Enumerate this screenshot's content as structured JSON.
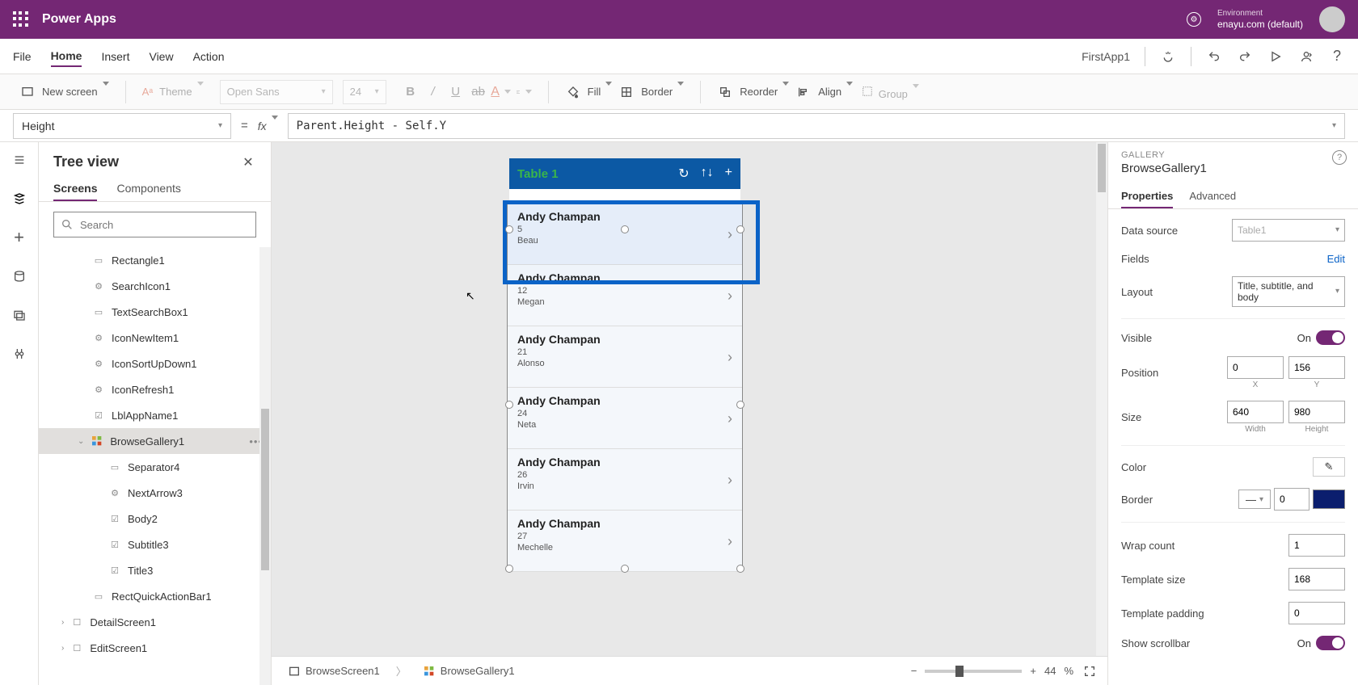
{
  "topbar": {
    "brand": "Power Apps",
    "env_label": "Environment",
    "env_value": "enayu.com (default)"
  },
  "menubar": {
    "items": [
      "File",
      "Home",
      "Insert",
      "View",
      "Action"
    ],
    "active": "Home",
    "app_name": "FirstApp1"
  },
  "toolbar": {
    "new_screen": "New screen",
    "theme": "Theme",
    "font": "Open Sans",
    "font_size": "24",
    "fill": "Fill",
    "border": "Border",
    "reorder": "Reorder",
    "align": "Align",
    "group": "Group"
  },
  "formula": {
    "property": "Height",
    "expr": "Parent.Height - Self.Y"
  },
  "tree": {
    "title": "Tree view",
    "tabs": [
      "Screens",
      "Components"
    ],
    "active_tab": "Screens",
    "search_placeholder": "Search",
    "items": [
      {
        "label": "Rectangle1",
        "indent": 1,
        "icon": "rect"
      },
      {
        "label": "SearchIcon1",
        "indent": 1,
        "icon": "ctl"
      },
      {
        "label": "TextSearchBox1",
        "indent": 1,
        "icon": "input"
      },
      {
        "label": "IconNewItem1",
        "indent": 1,
        "icon": "ctl"
      },
      {
        "label": "IconSortUpDown1",
        "indent": 1,
        "icon": "ctl"
      },
      {
        "label": "IconRefresh1",
        "indent": 1,
        "icon": "ctl"
      },
      {
        "label": "LblAppName1",
        "indent": 1,
        "icon": "label"
      },
      {
        "label": "BrowseGallery1",
        "indent": 1,
        "icon": "gallery",
        "selected": true,
        "expandable": true
      },
      {
        "label": "Separator4",
        "indent": 2,
        "icon": "rect"
      },
      {
        "label": "NextArrow3",
        "indent": 2,
        "icon": "ctl"
      },
      {
        "label": "Body2",
        "indent": 2,
        "icon": "label"
      },
      {
        "label": "Subtitle3",
        "indent": 2,
        "icon": "label"
      },
      {
        "label": "Title3",
        "indent": 2,
        "icon": "label"
      },
      {
        "label": "RectQuickActionBar1",
        "indent": 1,
        "icon": "rect"
      },
      {
        "label": "DetailScreen1",
        "indent": 0,
        "icon": "screen",
        "expandable": true
      },
      {
        "label": "EditScreen1",
        "indent": 0,
        "icon": "screen",
        "expandable": true
      }
    ]
  },
  "phone": {
    "title": "Table 1",
    "records": [
      {
        "title": "Andy Champan",
        "sub1": "5",
        "sub2": "Beau"
      },
      {
        "title": "Andy Champan",
        "sub1": "12",
        "sub2": "Megan"
      },
      {
        "title": "Andy Champan",
        "sub1": "21",
        "sub2": "Alonso"
      },
      {
        "title": "Andy Champan",
        "sub1": "24",
        "sub2": "Neta"
      },
      {
        "title": "Andy Champan",
        "sub1": "26",
        "sub2": "Irvin"
      },
      {
        "title": "Andy Champan",
        "sub1": "27",
        "sub2": "Mechelle"
      }
    ]
  },
  "props": {
    "category": "GALLERY",
    "name": "BrowseGallery1",
    "tabs": [
      "Properties",
      "Advanced"
    ],
    "active_tab": "Properties",
    "data_source_label": "Data source",
    "data_source_value": "Table1",
    "fields_label": "Fields",
    "fields_edit": "Edit",
    "layout_label": "Layout",
    "layout_value": "Title, subtitle, and body",
    "visible_label": "Visible",
    "visible_value": "On",
    "position_label": "Position",
    "pos_x": "0",
    "pos_y": "156",
    "pos_x_label": "X",
    "pos_y_label": "Y",
    "size_label": "Size",
    "width": "640",
    "height": "980",
    "width_label": "Width",
    "height_label": "Height",
    "color_label": "Color",
    "border_label": "Border",
    "border_width": "0",
    "wrap_label": "Wrap count",
    "wrap_value": "1",
    "template_size_label": "Template size",
    "template_size": "168",
    "template_padding_label": "Template padding",
    "template_padding": "0",
    "show_scrollbar_label": "Show scrollbar",
    "show_scrollbar_value": "On"
  },
  "status": {
    "crumb1": "BrowseScreen1",
    "crumb2": "BrowseGallery1",
    "zoom": "44",
    "zoom_pct": "%"
  }
}
